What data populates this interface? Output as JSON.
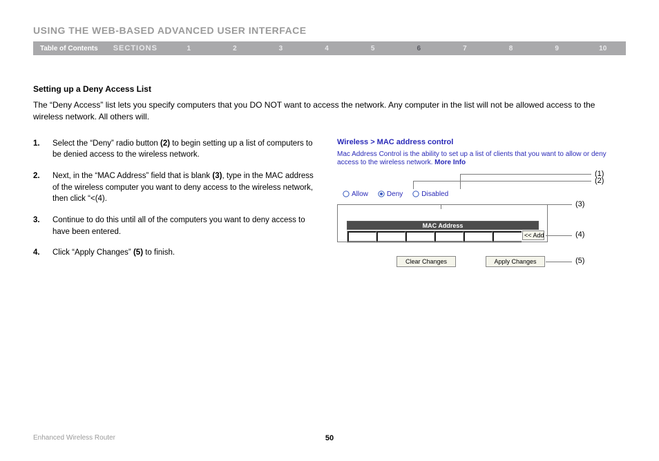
{
  "header": {
    "title": "USING THE WEB-BASED ADVANCED USER INTERFACE",
    "toc": "Table of Contents",
    "sections_label": "SECTIONS",
    "nums": [
      "1",
      "2",
      "3",
      "4",
      "5",
      "6",
      "7",
      "8",
      "9",
      "10"
    ],
    "active": "6"
  },
  "subhead": "Setting up a Deny Access List",
  "intro": "The “Deny Access” list lets you specify computers that you DO NOT want to access the network. Any computer in the list will not be allowed access to the wireless network. All others will.",
  "steps": [
    {
      "n": "1.",
      "html": "Select the “Deny” radio button <b>(2)</b> to begin setting up a list of computers to be denied access to the wireless network."
    },
    {
      "n": "2.",
      "html": "Next, in the “MAC Address” field that is blank <b>(3)</b>, type in the MAC address of the wireless computer you want to deny access to the wireless network, then click “<<Add” <b>(4)</b>."
    },
    {
      "n": "3.",
      "html": "Continue to do this until all of the computers you want to deny access to have been entered."
    },
    {
      "n": "4.",
      "html": "Click “Apply Changes” <b>(5)</b> to finish."
    }
  ],
  "fig": {
    "breadcrumb": "Wireless > MAC address control",
    "desc": "Mac Address Control is the ability to set up a list of clients that you want to allow or deny access to the wireless network. ",
    "more": "More Info",
    "radios": {
      "allow": "Allow",
      "deny": "Deny",
      "disabled": "Disabled"
    },
    "thead": "MAC Address",
    "add": "<< Add",
    "clear": "Clear Changes",
    "apply": "Apply Changes",
    "callouts": {
      "c1": "(1)",
      "c2": "(2)",
      "c3": "(3)",
      "c4": "(4)",
      "c5": "(5)"
    }
  },
  "footer": {
    "left": "Enhanced Wireless Router",
    "page": "50"
  }
}
